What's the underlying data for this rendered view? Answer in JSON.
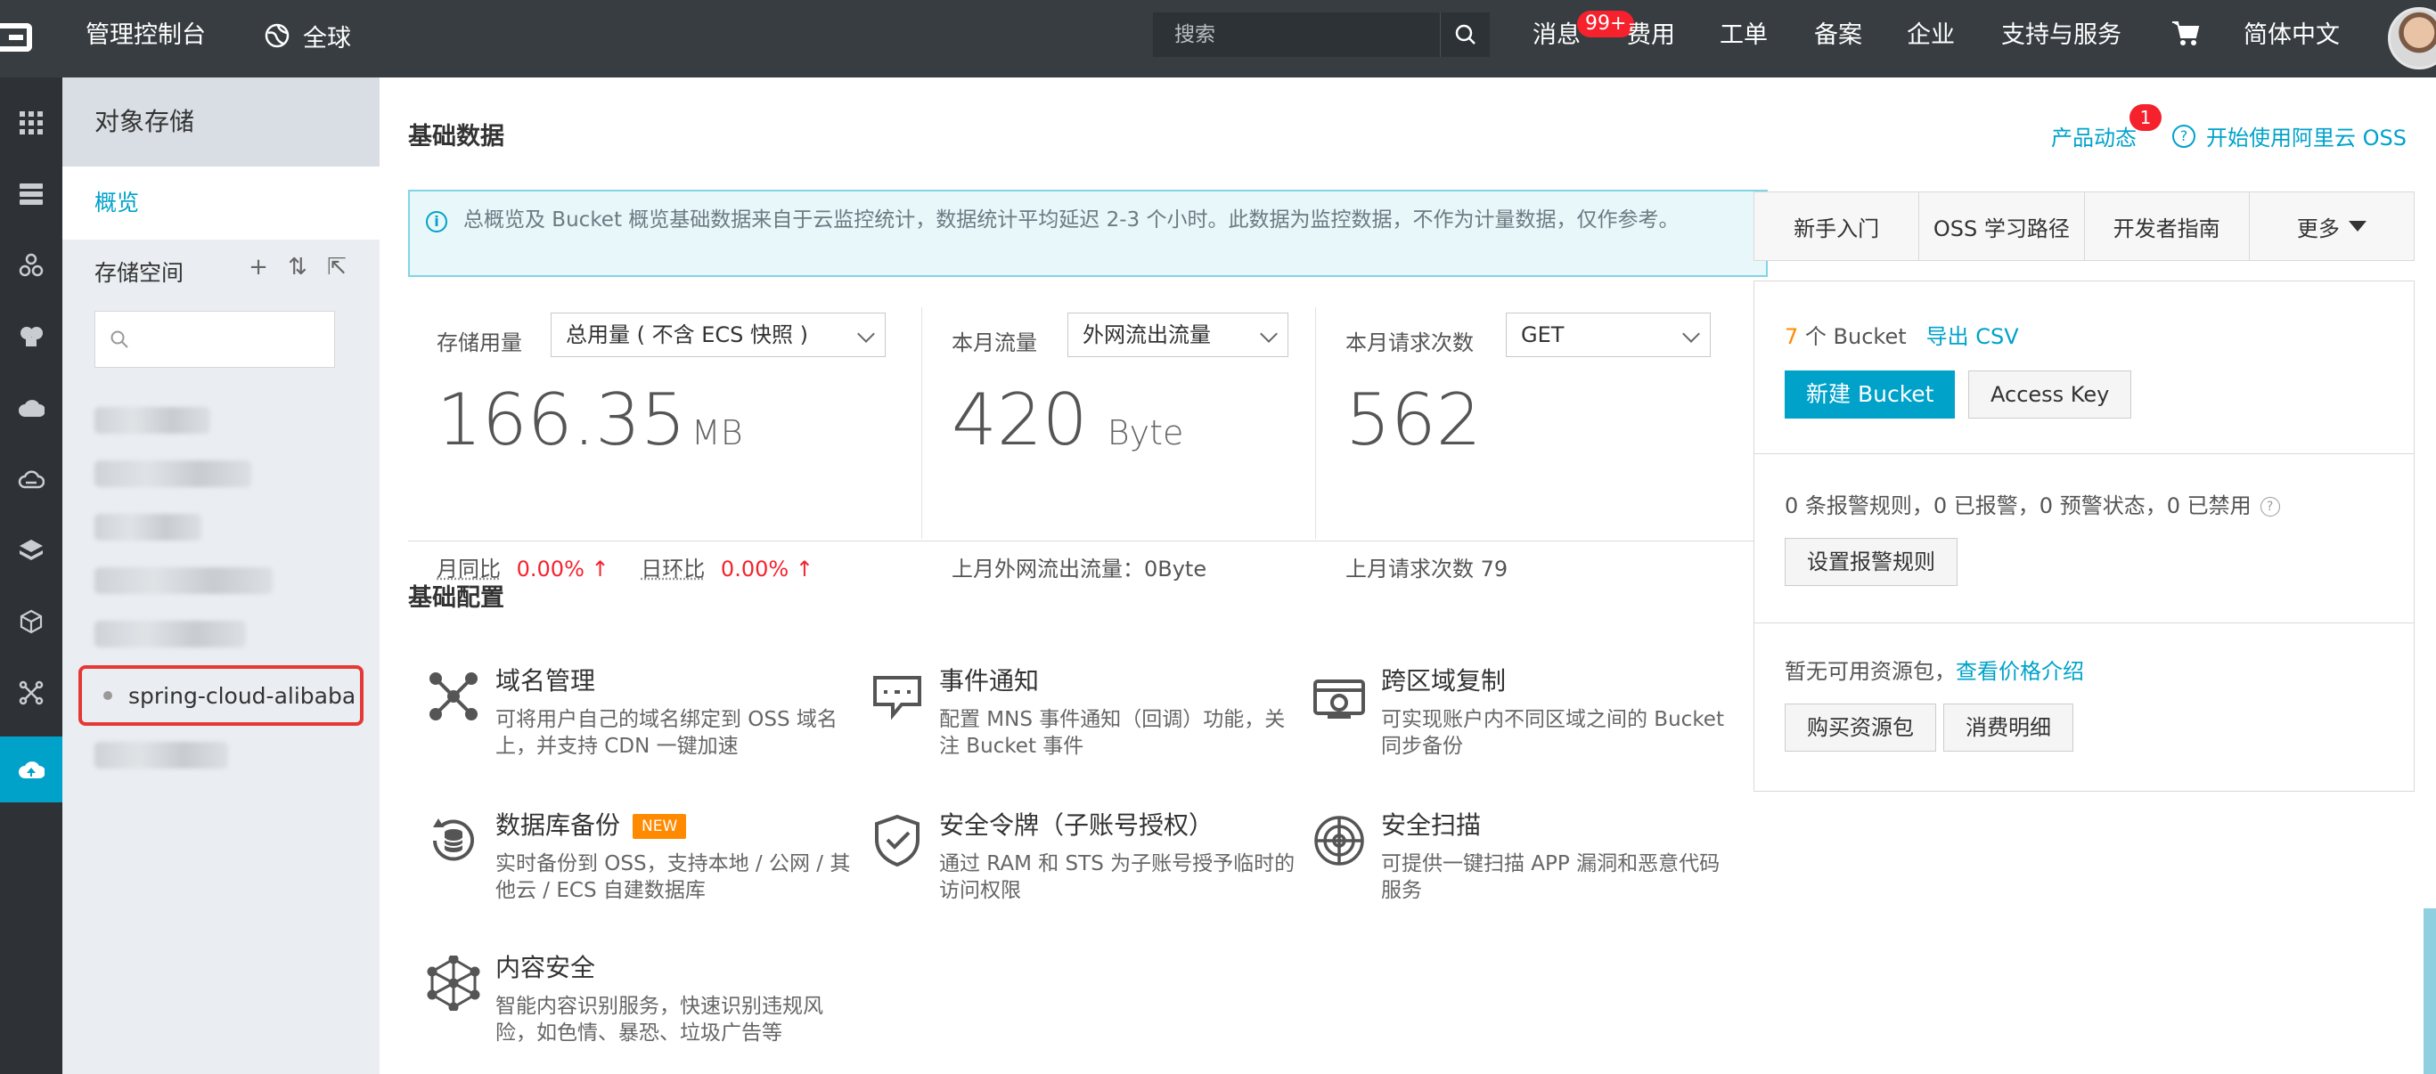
{
  "topbar": {
    "title": "管理控制台",
    "region": "全球",
    "search_placeholder": "搜索",
    "nav": {
      "messages": "消息",
      "messages_badge": "99+",
      "billing": "费用",
      "tickets": "工单",
      "icp": "备案",
      "enterprise": "企业",
      "support": "支持与服务",
      "language": "简体中文"
    }
  },
  "sidebar": {
    "title": "对象存储",
    "overview": "概览",
    "storage_label": "存储空间",
    "search_placeholder": "",
    "active_bucket": "spring-cloud-alibaba"
  },
  "main": {
    "basic_data_title": "基础数据",
    "notice": "总概览及 Bucket 概览基础数据来自于云监控统计，数据统计平均延迟 2-3 个小时。此数据为监控数据，不作为计量数据，仅作参考。",
    "stats": [
      {
        "label": "存储用量",
        "select": "总用量 ( 不含 ECS 快照 )",
        "value": "166.35",
        "unit": "MB",
        "yoy_label": "月同比",
        "yoy_value": "0.00%",
        "dod_label": "日环比",
        "dod_value": "0.00%"
      },
      {
        "label": "本月流量",
        "select": "外网流出流量",
        "value": "420",
        "unit": "Byte",
        "sub": "上月外网流出流量：0Byte"
      },
      {
        "label": "本月请求次数",
        "select": "GET",
        "value": "562",
        "unit": "",
        "sub": "上月请求次数  79"
      }
    ],
    "config_title": "基础配置",
    "configs": [
      {
        "title": "域名管理",
        "desc": "可将用户自己的域名绑定到 OSS 域名上，并支持 CDN 一键加速",
        "icon": "domain-icon"
      },
      {
        "title": "事件通知",
        "desc": "配置 MNS 事件通知（回调）功能，关注 Bucket 事件",
        "icon": "event-icon"
      },
      {
        "title": "跨区域复制",
        "desc": "可实现账户内不同区域之间的 Bucket 同步备份",
        "icon": "replication-icon"
      },
      {
        "title": "数据库备份",
        "tag": "NEW",
        "desc": "实时备份到 OSS，支持本地 / 公网 / 其他云 / ECS 自建数据库",
        "icon": "database-backup-icon"
      },
      {
        "title": "安全令牌（子账号授权）",
        "desc": "通过 RAM 和 STS 为子账号授予临时的访问权限",
        "icon": "security-token-icon"
      },
      {
        "title": "安全扫描",
        "desc": "可提供一键扫描 APP 漏洞和恶意代码服务",
        "icon": "security-scan-icon"
      },
      {
        "title": "内容安全",
        "desc": "智能内容识别服务，快速识别违规风险，如色情、暴恐、垃圾广告等",
        "icon": "content-security-icon"
      }
    ]
  },
  "right": {
    "product_news": "产品动态",
    "product_news_badge": "1",
    "get_started": "开始使用阿里云 OSS",
    "tabs": [
      "新手入门",
      "OSS 学习路径",
      "开发者指南",
      "更多"
    ],
    "bucket_count": "7",
    "bucket_count_suffix": " 个 Bucket",
    "export_csv": "导出 CSV",
    "new_bucket": "新建 Bucket",
    "access_key": "Access Key",
    "alarm_summary": "0 条报警规则，0 已报警，0 预警状态，0 已禁用",
    "set_alarm": "设置报警规则",
    "resource_text": "暂无可用资源包，",
    "price_link": "查看价格介绍",
    "buy_pack": "购买资源包",
    "consume_detail": "消费明细"
  },
  "colors": {
    "accent": "#00a2ca",
    "topbar": "#373d41",
    "badge": "#f5222d",
    "new_tag": "#ff8a00"
  }
}
